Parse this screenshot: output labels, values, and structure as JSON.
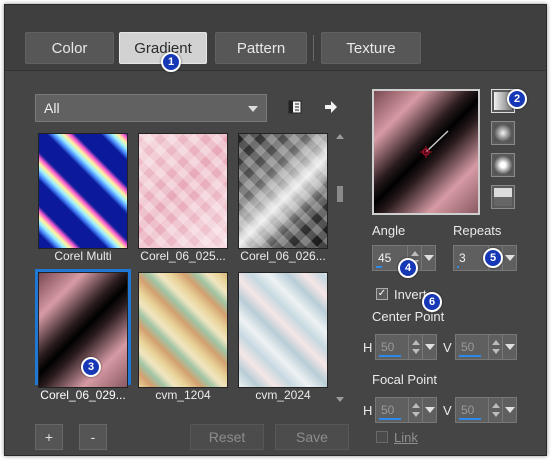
{
  "tabs": [
    {
      "label": "Color",
      "active": false
    },
    {
      "label": "Gradient",
      "active": true
    },
    {
      "label": "Pattern",
      "active": false
    },
    {
      "label": "Texture",
      "active": false
    }
  ],
  "callouts": [
    "1",
    "2",
    "3",
    "4",
    "5",
    "6"
  ],
  "category_dropdown": {
    "value": "All"
  },
  "icons": {
    "library": "book-icon",
    "export": "arrow-right-icon"
  },
  "gradients": [
    {
      "name": "Corel Multi",
      "selected": false
    },
    {
      "name": "Corel_06_025...",
      "selected": false
    },
    {
      "name": "Corel_06_026...",
      "selected": false
    },
    {
      "name": "Corel_06_029...",
      "selected": true
    },
    {
      "name": "cvm_1204",
      "selected": false
    },
    {
      "name": "cvm_2024",
      "selected": false
    }
  ],
  "bottom_buttons": {
    "add": "+",
    "remove": "-",
    "reset": "Reset",
    "save": "Save"
  },
  "gradient_styles": [
    "linear",
    "rectangular",
    "sunburst",
    "radial"
  ],
  "angle": {
    "label": "Angle",
    "value": "45",
    "level": 0.125
  },
  "repeats": {
    "label": "Repeats",
    "value": "3",
    "level": 0.03
  },
  "invert": {
    "label": "Invert",
    "checked": true
  },
  "center_point": {
    "label": "Center Point",
    "h_label": "H",
    "h_value": "50",
    "v_label": "V",
    "v_value": "50"
  },
  "focal_point": {
    "label": "Focal Point",
    "h_label": "H",
    "h_value": "50",
    "v_label": "V",
    "v_value": "50"
  },
  "link": {
    "label": "Link",
    "checked": false
  },
  "colors": {
    "selection": "#1e78d4",
    "callout": "#1637b6",
    "panel": "#454545",
    "spin_bar": "#2e8ae8"
  }
}
